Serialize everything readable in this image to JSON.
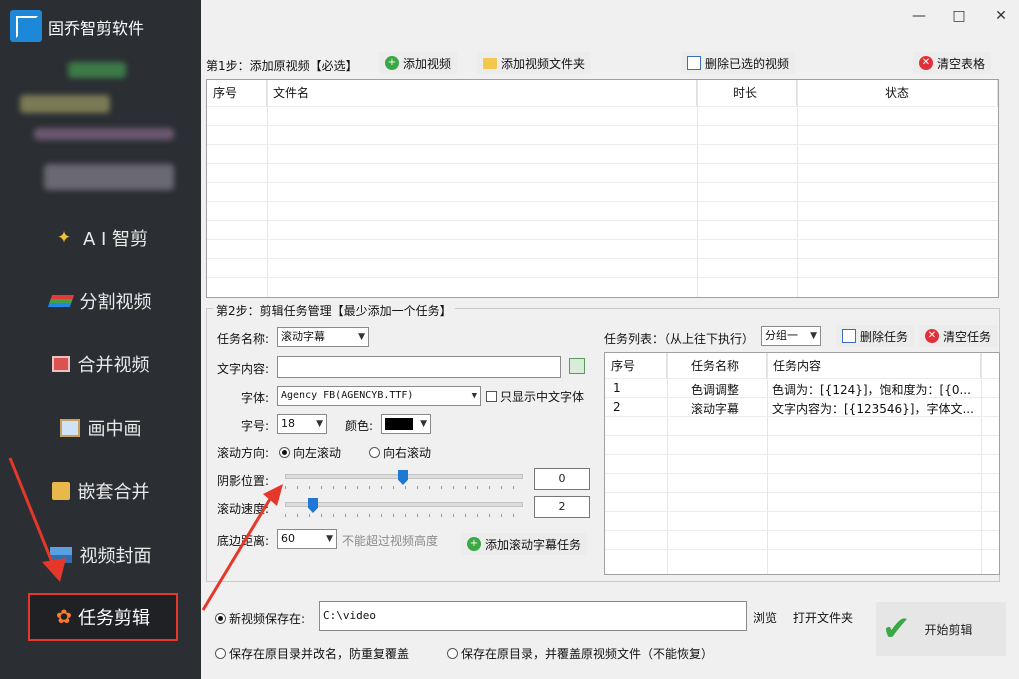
{
  "app": {
    "title": "固乔智剪软件"
  },
  "sidebar": {
    "items": [
      {
        "label": "A I 智剪",
        "icon": "ai-wand-icon"
      },
      {
        "label": "分割视频",
        "icon": "split-video-icon"
      },
      {
        "label": "合并视频",
        "icon": "merge-video-icon"
      },
      {
        "label": "画中画",
        "icon": "picture-in-picture-icon"
      },
      {
        "label": "嵌套合并",
        "icon": "nested-merge-icon"
      },
      {
        "label": "视频封面",
        "icon": "video-cover-icon"
      }
    ],
    "active": {
      "label": "任务剪辑",
      "icon": "flower-task-icon"
    }
  },
  "window": {
    "minimize": "—",
    "maximize": "□",
    "close": "✕"
  },
  "step1": {
    "label": "第1步：添加原视频【必选】",
    "add_video": "添加视频",
    "add_folder": "添加视频文件夹",
    "delete_selected": "删除已选的视频",
    "clear_table": "清空表格",
    "columns": [
      "序号",
      "文件名",
      "时长",
      "状态"
    ]
  },
  "step2": {
    "label": "第2步：剪辑任务管理【最少添加一个任务】",
    "task_name_label": "任务名称:",
    "task_name_value": "滚动字幕",
    "text_label": "文字内容:",
    "text_value": "",
    "font_label": "字体:",
    "font_value": "Agency FB(AGENCYB.TTF)",
    "only_chinese": "只显示中文字体",
    "size_label": "字号:",
    "size_value": "18",
    "color_label": "颜色:",
    "color_value": "#000000",
    "direction_label": "滚动方向:",
    "dir_left": "向左滚动",
    "dir_right": "向右滚动",
    "shadow_label": "阴影位置:",
    "shadow_value": "0",
    "speed_label": "滚动速度:",
    "speed_value": "2",
    "bottom_label": "底边距离:",
    "bottom_value": "60",
    "bottom_hint": "不能超过视频高度",
    "add_task": "添加滚动字幕任务",
    "task_list_label": "任务列表：（从上往下执行）",
    "group_value": "分组一",
    "delete_task": "删除任务",
    "clear_task": "清空任务",
    "task_columns": [
      "序号",
      "任务名称",
      "任务内容"
    ],
    "tasks": [
      {
        "no": "1",
        "name": "色调调整",
        "content": "色调为：[{124}]，饱和度为：[{0..."
      },
      {
        "no": "2",
        "name": "滚动字幕",
        "content": "文字内容为：[{123546}]，字体文..."
      }
    ]
  },
  "output": {
    "save_new_label": "新视频保存在:",
    "path": "C:\\video",
    "browse": "浏览",
    "open_folder": "打开文件夹",
    "opt_rename": "保存在原目录并改名，防重复覆盖",
    "opt_overwrite": "保存在原目录，并覆盖原视频文件（不能恢复）",
    "start": "开始剪辑"
  }
}
